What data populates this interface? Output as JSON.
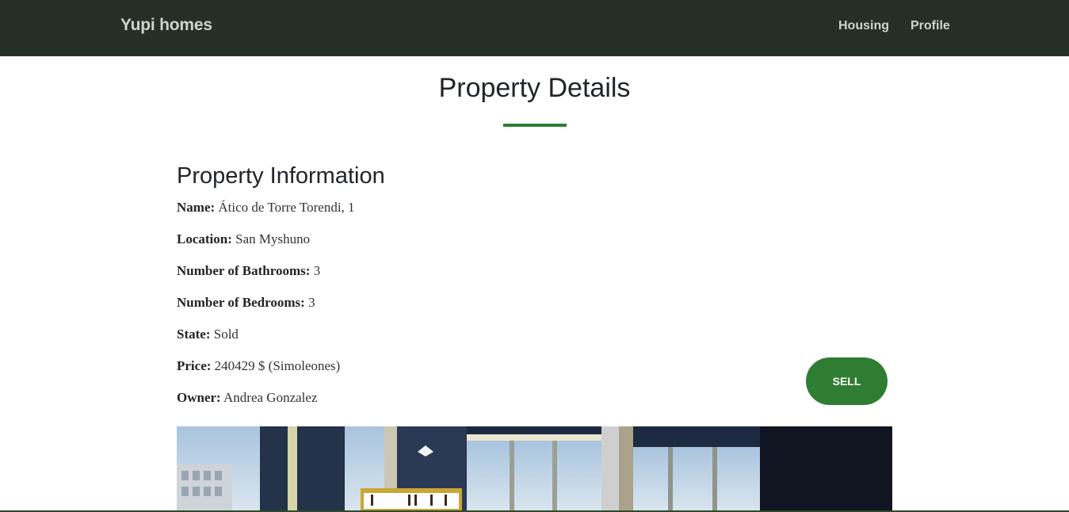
{
  "navbar": {
    "brand": "Yupi homes",
    "links": [
      {
        "label": "Housing"
      },
      {
        "label": "Profile"
      }
    ]
  },
  "page": {
    "title": "Property Details",
    "accent_color": "#2f7d32"
  },
  "property": {
    "section_title": "Property Information",
    "fields": [
      {
        "label": "Name:",
        "value": "Ático de Torre Torendi, 1"
      },
      {
        "label": "Location:",
        "value": "San Myshuno"
      },
      {
        "label": "Number of Bathrooms:",
        "value": "3"
      },
      {
        "label": "Number of Bedrooms:",
        "value": "3"
      },
      {
        "label": "State:",
        "value": "Sold"
      },
      {
        "label": "Price:",
        "value": "240429 $ (Simoleones)"
      },
      {
        "label": "Owner:",
        "value": "Andrea Gonzalez"
      }
    ],
    "sell_label": "SELL"
  }
}
